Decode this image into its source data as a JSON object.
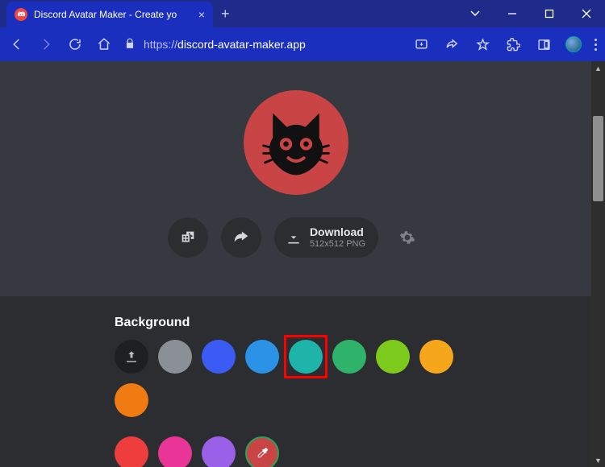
{
  "window": {
    "tab_title": "Discord Avatar Maker - Create yo",
    "url_protocol": "https://",
    "url_host": "discord-avatar-maker.app"
  },
  "avatar": {
    "bg_color": "#c94444"
  },
  "actions": {
    "download_label": "Download",
    "download_subtext": "512x512 PNG"
  },
  "section": {
    "title": "Background"
  },
  "swatches": [
    {
      "color": "#8b9096"
    },
    {
      "color": "#3a5cf4"
    },
    {
      "color": "#2a93e8"
    },
    {
      "color": "#1fb4a9",
      "selected": true
    },
    {
      "color": "#2fb36a"
    },
    {
      "color": "#7ccb1c"
    },
    {
      "color": "#f6a61b"
    },
    {
      "color": "#f07b12"
    },
    {
      "color": "#ee3d3d"
    },
    {
      "color": "#e83597"
    },
    {
      "color": "#9b60e8"
    }
  ]
}
